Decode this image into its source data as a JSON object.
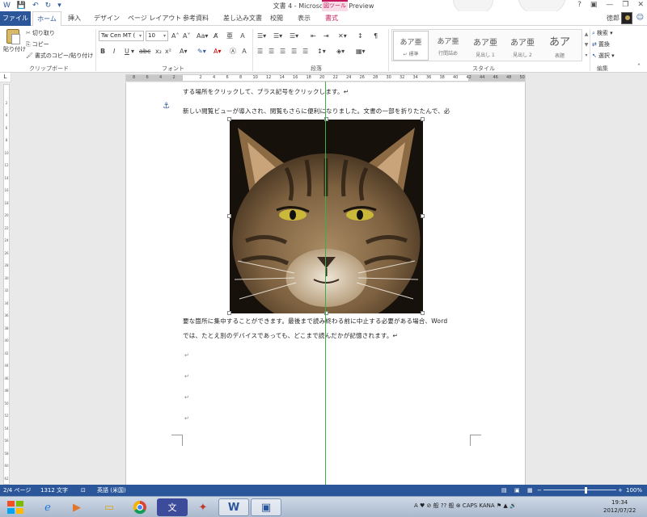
{
  "window": {
    "title": "文書 4 - Microsoft Word Preview",
    "context_tab_group": "図ツール",
    "controls": [
      "?",
      "▣",
      "—",
      "❐",
      "✕"
    ]
  },
  "qat": [
    "save-icon",
    "undo-icon",
    "redo-icon",
    "customize-icon"
  ],
  "tabs": {
    "file": "ファイル",
    "home": "ホーム",
    "items": [
      "挿入",
      "デザイン",
      "ページ レイアウト",
      "参考資料",
      "差し込み文書",
      "校閲",
      "表示",
      "書式"
    ]
  },
  "user": {
    "name": "徳郎"
  },
  "ribbon": {
    "clipboard": {
      "paste": "貼り付け",
      "cut": "切り取り",
      "copy": "コピー",
      "format_painter": "書式のコピー/貼り付け",
      "label": "クリップボード"
    },
    "font": {
      "font_name": "Tw Cen MT (",
      "font_size": "10",
      "label": "フォント"
    },
    "paragraph": {
      "label": "段落"
    },
    "styles": {
      "label": "スタイル",
      "items": [
        {
          "sample": "あア亜",
          "name": "↵ 標準"
        },
        {
          "sample": "あア亜",
          "name": "行間詰め"
        },
        {
          "sample": "あア亜",
          "name": "見出し 1"
        },
        {
          "sample": "あア亜",
          "name": "見出し 2"
        },
        {
          "sample": "あア",
          "name": "表題"
        }
      ]
    },
    "editing": {
      "label": "編集",
      "find": "検索",
      "replace": "置換",
      "select": "選択"
    }
  },
  "ruler": {
    "horizontal": [
      "8",
      "6",
      "4",
      "2",
      "",
      "2",
      "4",
      "6",
      "8",
      "10",
      "12",
      "14",
      "16",
      "18",
      "20",
      "22",
      "24",
      "26",
      "28",
      "30",
      "32",
      "34",
      "36",
      "38",
      "40",
      "42",
      "44",
      "46",
      "48",
      "50"
    ],
    "vertical": [
      "",
      "2",
      "4",
      "6",
      "8",
      "10",
      "12",
      "14",
      "16",
      "18",
      "20",
      "22",
      "24",
      "26",
      "28",
      "30",
      "32",
      "34",
      "36",
      "38",
      "40",
      "42",
      "44",
      "46",
      "48",
      "50",
      "52",
      "54",
      "56",
      "58",
      "60",
      "62"
    ]
  },
  "document": {
    "line1": "する場所をクリックして、プラス記号をクリックします。↵",
    "line2": "新しい閲覧ビューが導入され、閲覧もさらに便利になりました。文書の一部を折りたたんで、必",
    "line3": "要な箇所に集中することができます。最後まで読み終わる前に中止する必要がある場合、Word",
    "line4": "では、たとえ別のデバイスであっても、どこまで読んだかが記憶されます。↵",
    "para_mark": "↵"
  },
  "status": {
    "page": "2/4 ページ",
    "words": "1312 文字",
    "language": "英語 (米国)",
    "zoom": "100%"
  },
  "taskbar": {
    "apps": [
      "ie-icon",
      "media-player-icon",
      "explorer-icon",
      "chrome-icon",
      "app-icon",
      "pdf-icon",
      "word-2010-icon",
      "word-preview-icon"
    ],
    "tray": "A ♥ ⊘ 般 ?? 般 ⊗ CAPS KANA ⚑ ▲ 🔊",
    "time": "19:34",
    "date": "2012/07/22"
  }
}
